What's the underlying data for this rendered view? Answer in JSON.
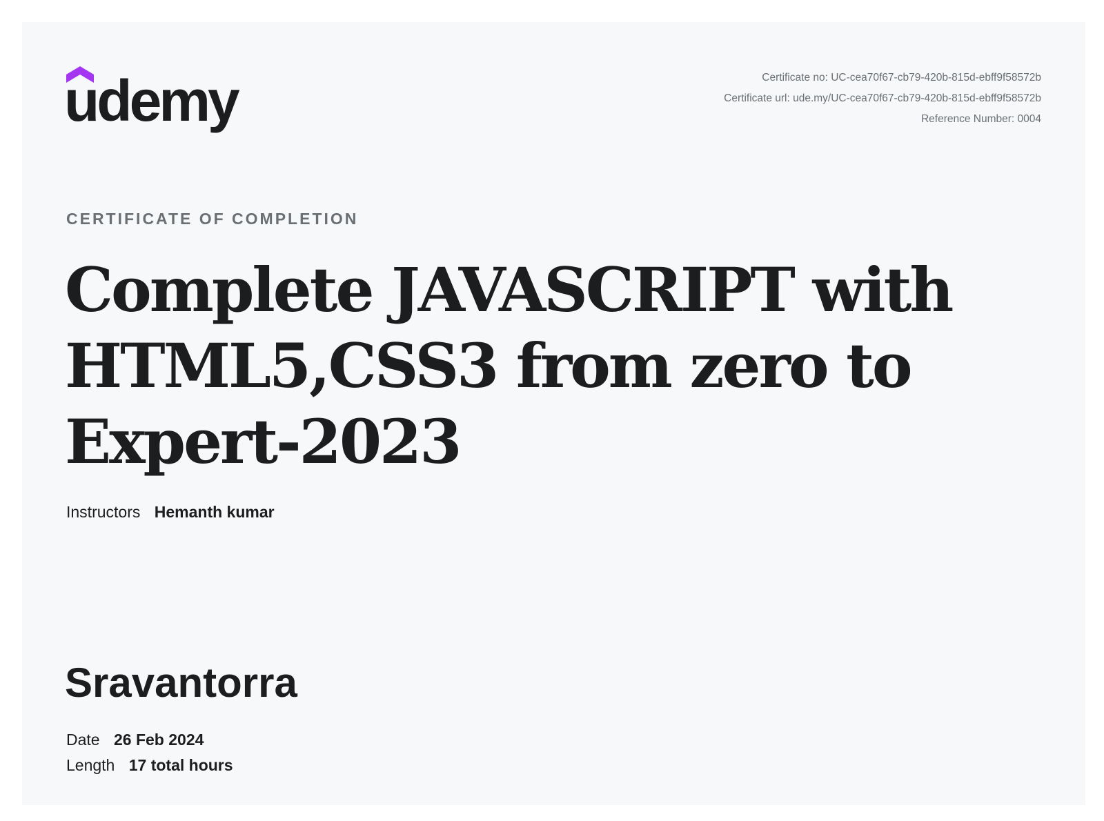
{
  "brand": {
    "logo_text": "udemy",
    "accent_color": "#a435f0",
    "text_color": "#1c1d1f",
    "muted_color": "#6a6f73",
    "background_color": "#f7f8fa"
  },
  "meta": {
    "certificate_no": "Certificate no: UC-cea70f67-cb79-420b-815d-ebff9f58572b",
    "certificate_url": "Certificate url: ude.my/UC-cea70f67-cb79-420b-815d-ebff9f58572b",
    "reference_number": "Reference Number: 0004"
  },
  "eyebrow": "CERTIFICATE OF COMPLETION",
  "course_title": "Complete JAVASCRIPT with HTML5,CSS3 from zero to Expert-2023",
  "instructors": {
    "label": "Instructors",
    "value": "Hemanth kumar"
  },
  "student_name": "Sravantorra",
  "details": {
    "date_label": "Date",
    "date_value": "26 Feb 2024",
    "length_label": "Length",
    "length_value": "17 total hours"
  }
}
